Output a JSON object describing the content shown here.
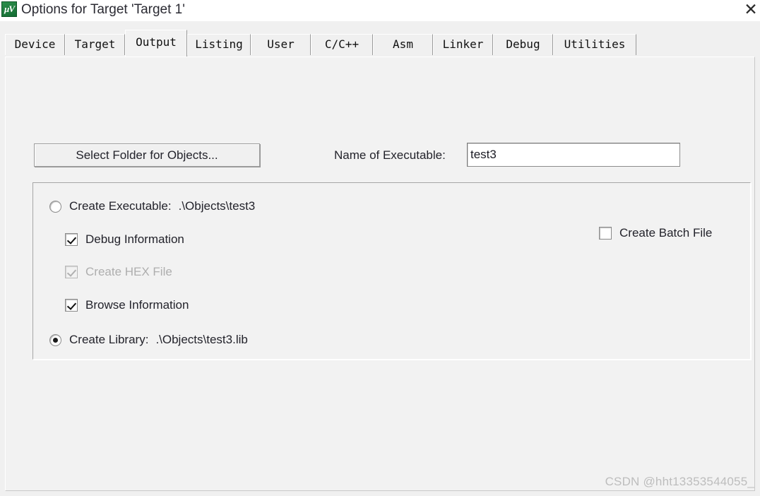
{
  "window": {
    "title": "Options for Target 'Target 1'",
    "icon": "keil-uvision-icon",
    "icon_glyph": "µV",
    "close_label": "✕"
  },
  "tabs": [
    {
      "id": "device",
      "label": "Device",
      "selected": false
    },
    {
      "id": "target",
      "label": "Target",
      "selected": false
    },
    {
      "id": "output",
      "label": "Output",
      "selected": true
    },
    {
      "id": "listing",
      "label": "Listing",
      "selected": false
    },
    {
      "id": "user",
      "label": "User",
      "selected": false
    },
    {
      "id": "c-cpp",
      "label": "C/C++",
      "selected": false
    },
    {
      "id": "asm",
      "label": "Asm",
      "selected": false
    },
    {
      "id": "linker",
      "label": "Linker",
      "selected": false
    },
    {
      "id": "debug",
      "label": "Debug",
      "selected": false
    },
    {
      "id": "utilities",
      "label": "Utilities",
      "selected": false
    }
  ],
  "output": {
    "select_folder_button": "Select Folder for Objects...",
    "executable_name_label": "Name of Executable:",
    "executable_name_value": "test3",
    "executable_name_placeholder": "",
    "create_executable": {
      "label": "Create Executable:",
      "path": ".\\Objects\\test3",
      "checked": false
    },
    "debug_information": {
      "label": "Debug Information",
      "checked": true,
      "disabled": false
    },
    "create_hex_file": {
      "label": "Create HEX File",
      "checked": true,
      "disabled": true
    },
    "browse_information": {
      "label": "Browse Information",
      "checked": true,
      "disabled": false
    },
    "create_library": {
      "label": "Create Library:",
      "path": ".\\Objects\\test3.lib",
      "checked": true
    },
    "create_batch_file": {
      "label": "Create Batch File",
      "checked": false,
      "disabled": false
    }
  },
  "watermark": "CSDN @hht13353544055_",
  "colors": {
    "dialog_bg": "#f0f0f0",
    "panel_bg": "#f2f2f2",
    "titlebar_bg": "#ffffff",
    "text": "#23232b",
    "disabled_text": "#aeaeae",
    "accent_icon": "#1f7a3d",
    "watermark": "#bdbdbd"
  }
}
